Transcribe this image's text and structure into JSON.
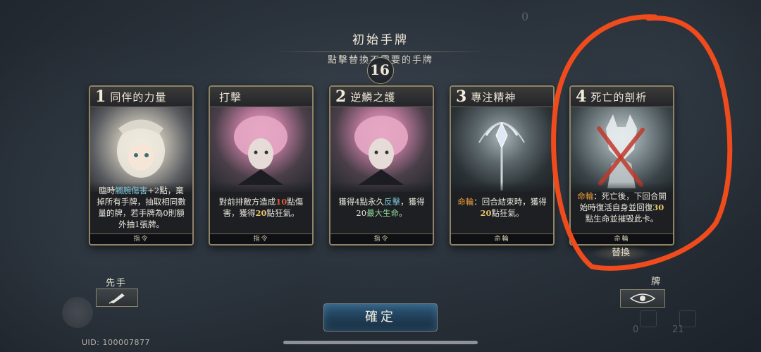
{
  "header": {
    "title": "初始手牌",
    "subtitle": "點擊替換不需要的手牌",
    "deck_count": "16"
  },
  "cards": [
    {
      "cost": "1",
      "name": "同伴的力量",
      "art": "blonde-girl",
      "desc_parts": [
        {
          "t": "臨時",
          "c": ""
        },
        {
          "t": "觸腕傷害",
          "c": "blue"
        },
        {
          "t": "+2點，棄掉所有手牌，抽取相同數量的牌，若手牌為0則額外抽1張牌。",
          "c": ""
        }
      ],
      "type": "指令"
    },
    {
      "cost": "",
      "name": "打擊",
      "art": "pink-hair",
      "desc_parts": [
        {
          "t": "對前排敵方造成",
          "c": ""
        },
        {
          "t": "10",
          "c": "red"
        },
        {
          "t": "點傷害，獲得",
          "c": ""
        },
        {
          "t": "20",
          "c": "gold"
        },
        {
          "t": "點狂氣。",
          "c": ""
        }
      ],
      "type": "指令"
    },
    {
      "cost": "2",
      "name": "逆鱗之護",
      "art": "pink-hair",
      "desc_parts": [
        {
          "t": "獲得4點永久",
          "c": ""
        },
        {
          "t": "反擊",
          "c": "blue"
        },
        {
          "t": "，獲得20",
          "c": ""
        },
        {
          "t": "最大生命",
          "c": "green"
        },
        {
          "t": "。",
          "c": ""
        }
      ],
      "type": "指令"
    },
    {
      "cost": "3",
      "name": "專注精神",
      "art": "staff",
      "desc_parts": [
        {
          "t": "命輪",
          "c": "orange"
        },
        {
          "t": "：回合結束時，獲得",
          "c": ""
        },
        {
          "t": "20",
          "c": "gold"
        },
        {
          "t": "點狂氣。",
          "c": ""
        }
      ],
      "type": "命輪"
    },
    {
      "cost": "4",
      "name": "死亡的剖析",
      "art": "fox",
      "desc_parts": [
        {
          "t": "命輪",
          "c": "orange"
        },
        {
          "t": "：死亡後，下回合開始時復活自身並回復",
          "c": ""
        },
        {
          "t": "30",
          "c": "gold"
        },
        {
          "t": "點生命並摧毀此卡。",
          "c": ""
        }
      ],
      "type": "命輪"
    }
  ],
  "replace_label": "替換",
  "bottom": {
    "first_player_label": "先手",
    "confirm_label": "確定",
    "uid_text": "UID: 100007877",
    "right_label": "牌",
    "right_count_a": "0",
    "right_count_b": "21",
    "top_count": "0"
  },
  "colors": {
    "annotation_circle": "#f04b1c",
    "cross": "#c0392b",
    "confirm_button": "#23455f"
  }
}
